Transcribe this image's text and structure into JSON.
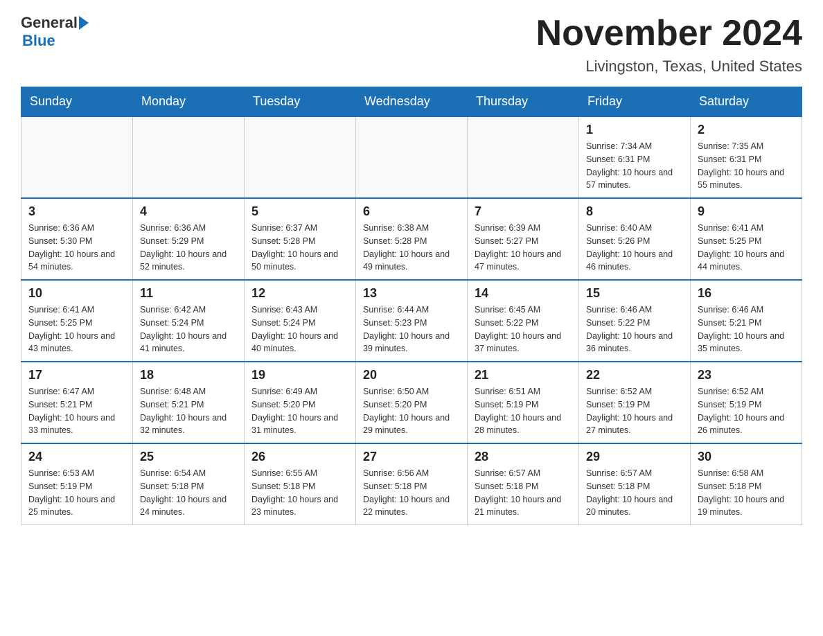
{
  "header": {
    "logo": {
      "part1": "General",
      "part2": "Blue"
    },
    "title": "November 2024",
    "location": "Livingston, Texas, United States"
  },
  "days_of_week": [
    "Sunday",
    "Monday",
    "Tuesday",
    "Wednesday",
    "Thursday",
    "Friday",
    "Saturday"
  ],
  "weeks": [
    [
      {
        "day": "",
        "info": ""
      },
      {
        "day": "",
        "info": ""
      },
      {
        "day": "",
        "info": ""
      },
      {
        "day": "",
        "info": ""
      },
      {
        "day": "",
        "info": ""
      },
      {
        "day": "1",
        "info": "Sunrise: 7:34 AM\nSunset: 6:31 PM\nDaylight: 10 hours and 57 minutes."
      },
      {
        "day": "2",
        "info": "Sunrise: 7:35 AM\nSunset: 6:31 PM\nDaylight: 10 hours and 55 minutes."
      }
    ],
    [
      {
        "day": "3",
        "info": "Sunrise: 6:36 AM\nSunset: 5:30 PM\nDaylight: 10 hours and 54 minutes."
      },
      {
        "day": "4",
        "info": "Sunrise: 6:36 AM\nSunset: 5:29 PM\nDaylight: 10 hours and 52 minutes."
      },
      {
        "day": "5",
        "info": "Sunrise: 6:37 AM\nSunset: 5:28 PM\nDaylight: 10 hours and 50 minutes."
      },
      {
        "day": "6",
        "info": "Sunrise: 6:38 AM\nSunset: 5:28 PM\nDaylight: 10 hours and 49 minutes."
      },
      {
        "day": "7",
        "info": "Sunrise: 6:39 AM\nSunset: 5:27 PM\nDaylight: 10 hours and 47 minutes."
      },
      {
        "day": "8",
        "info": "Sunrise: 6:40 AM\nSunset: 5:26 PM\nDaylight: 10 hours and 46 minutes."
      },
      {
        "day": "9",
        "info": "Sunrise: 6:41 AM\nSunset: 5:25 PM\nDaylight: 10 hours and 44 minutes."
      }
    ],
    [
      {
        "day": "10",
        "info": "Sunrise: 6:41 AM\nSunset: 5:25 PM\nDaylight: 10 hours and 43 minutes."
      },
      {
        "day": "11",
        "info": "Sunrise: 6:42 AM\nSunset: 5:24 PM\nDaylight: 10 hours and 41 minutes."
      },
      {
        "day": "12",
        "info": "Sunrise: 6:43 AM\nSunset: 5:24 PM\nDaylight: 10 hours and 40 minutes."
      },
      {
        "day": "13",
        "info": "Sunrise: 6:44 AM\nSunset: 5:23 PM\nDaylight: 10 hours and 39 minutes."
      },
      {
        "day": "14",
        "info": "Sunrise: 6:45 AM\nSunset: 5:22 PM\nDaylight: 10 hours and 37 minutes."
      },
      {
        "day": "15",
        "info": "Sunrise: 6:46 AM\nSunset: 5:22 PM\nDaylight: 10 hours and 36 minutes."
      },
      {
        "day": "16",
        "info": "Sunrise: 6:46 AM\nSunset: 5:21 PM\nDaylight: 10 hours and 35 minutes."
      }
    ],
    [
      {
        "day": "17",
        "info": "Sunrise: 6:47 AM\nSunset: 5:21 PM\nDaylight: 10 hours and 33 minutes."
      },
      {
        "day": "18",
        "info": "Sunrise: 6:48 AM\nSunset: 5:21 PM\nDaylight: 10 hours and 32 minutes."
      },
      {
        "day": "19",
        "info": "Sunrise: 6:49 AM\nSunset: 5:20 PM\nDaylight: 10 hours and 31 minutes."
      },
      {
        "day": "20",
        "info": "Sunrise: 6:50 AM\nSunset: 5:20 PM\nDaylight: 10 hours and 29 minutes."
      },
      {
        "day": "21",
        "info": "Sunrise: 6:51 AM\nSunset: 5:19 PM\nDaylight: 10 hours and 28 minutes."
      },
      {
        "day": "22",
        "info": "Sunrise: 6:52 AM\nSunset: 5:19 PM\nDaylight: 10 hours and 27 minutes."
      },
      {
        "day": "23",
        "info": "Sunrise: 6:52 AM\nSunset: 5:19 PM\nDaylight: 10 hours and 26 minutes."
      }
    ],
    [
      {
        "day": "24",
        "info": "Sunrise: 6:53 AM\nSunset: 5:19 PM\nDaylight: 10 hours and 25 minutes."
      },
      {
        "day": "25",
        "info": "Sunrise: 6:54 AM\nSunset: 5:18 PM\nDaylight: 10 hours and 24 minutes."
      },
      {
        "day": "26",
        "info": "Sunrise: 6:55 AM\nSunset: 5:18 PM\nDaylight: 10 hours and 23 minutes."
      },
      {
        "day": "27",
        "info": "Sunrise: 6:56 AM\nSunset: 5:18 PM\nDaylight: 10 hours and 22 minutes."
      },
      {
        "day": "28",
        "info": "Sunrise: 6:57 AM\nSunset: 5:18 PM\nDaylight: 10 hours and 21 minutes."
      },
      {
        "day": "29",
        "info": "Sunrise: 6:57 AM\nSunset: 5:18 PM\nDaylight: 10 hours and 20 minutes."
      },
      {
        "day": "30",
        "info": "Sunrise: 6:58 AM\nSunset: 5:18 PM\nDaylight: 10 hours and 19 minutes."
      }
    ]
  ]
}
